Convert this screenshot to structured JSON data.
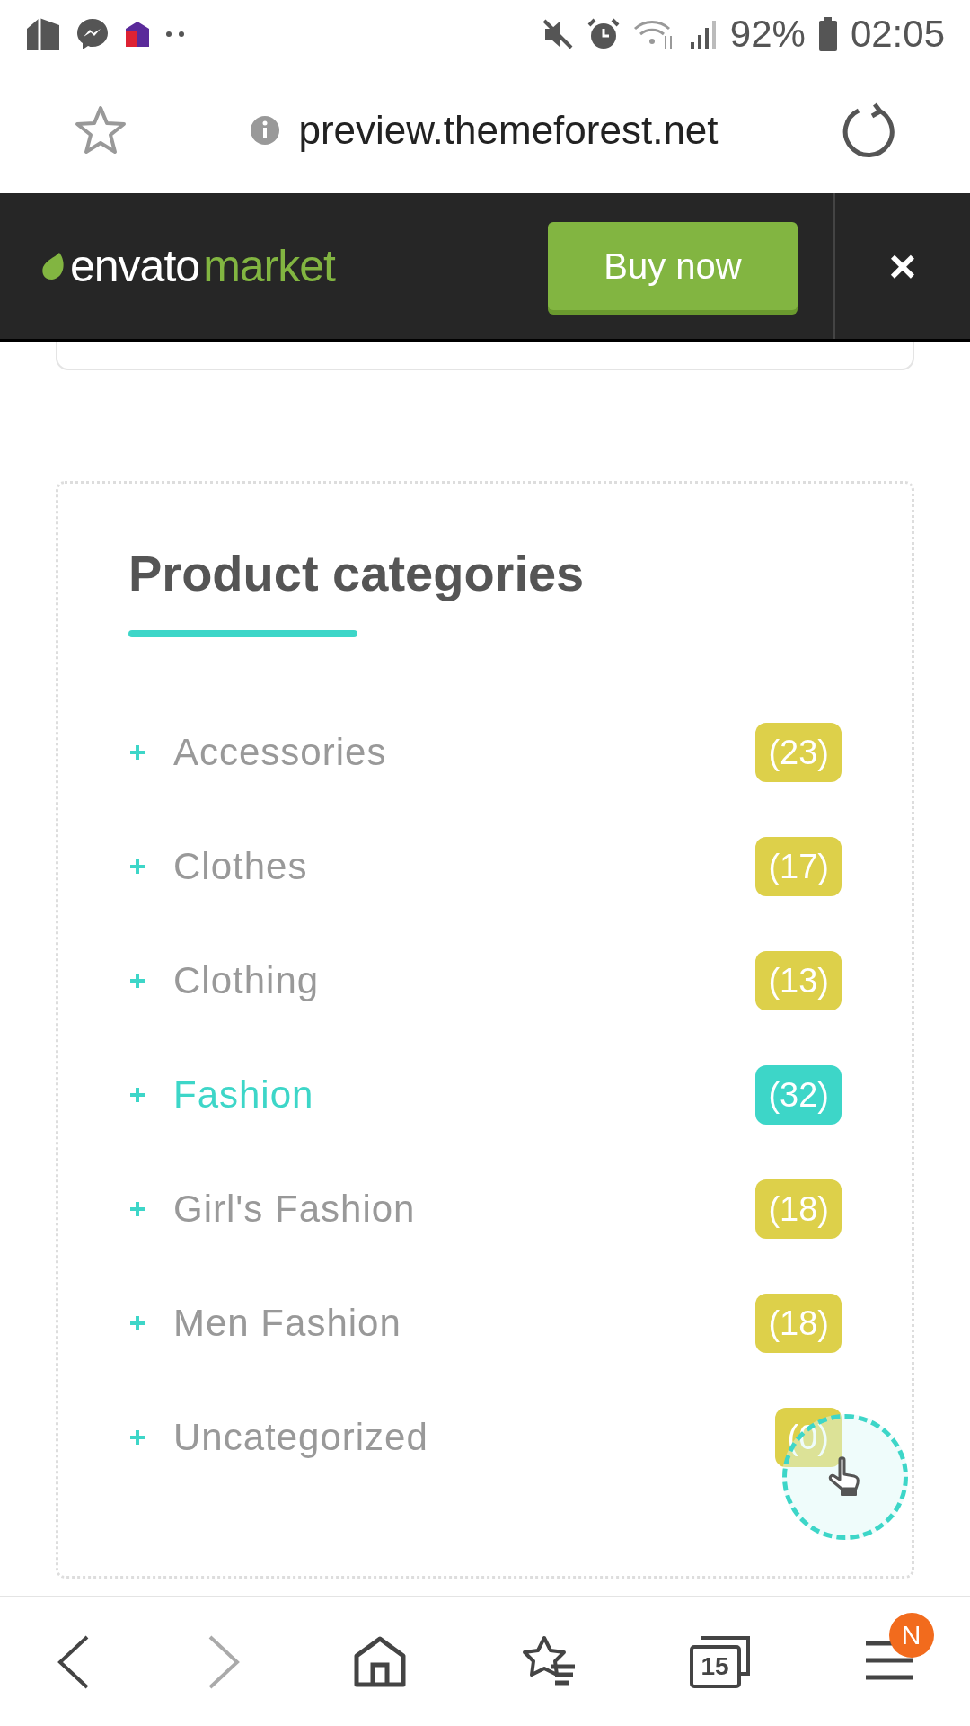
{
  "status_bar": {
    "battery": "92%",
    "time": "02:05"
  },
  "browser": {
    "url": "preview.themeforest.net"
  },
  "banner": {
    "logo": {
      "primary": "envato",
      "secondary": "market"
    },
    "button": "Buy now",
    "close": "×"
  },
  "widget": {
    "title": "Product categories",
    "categories": [
      {
        "label": "Accessories",
        "count": "(23)",
        "selected": false
      },
      {
        "label": "Clothes",
        "count": "(17)",
        "selected": false
      },
      {
        "label": "Clothing",
        "count": "(13)",
        "selected": false
      },
      {
        "label": "Fashion",
        "count": "(32)",
        "selected": true
      },
      {
        "label": "Girl's Fashion",
        "count": "(18)",
        "selected": false
      },
      {
        "label": "Men Fashion",
        "count": "(18)",
        "selected": false
      },
      {
        "label": "Uncategorized",
        "count": "(0)",
        "selected": false
      }
    ]
  },
  "bottom_nav": {
    "tabs_count": "15",
    "menu_badge": "N"
  }
}
